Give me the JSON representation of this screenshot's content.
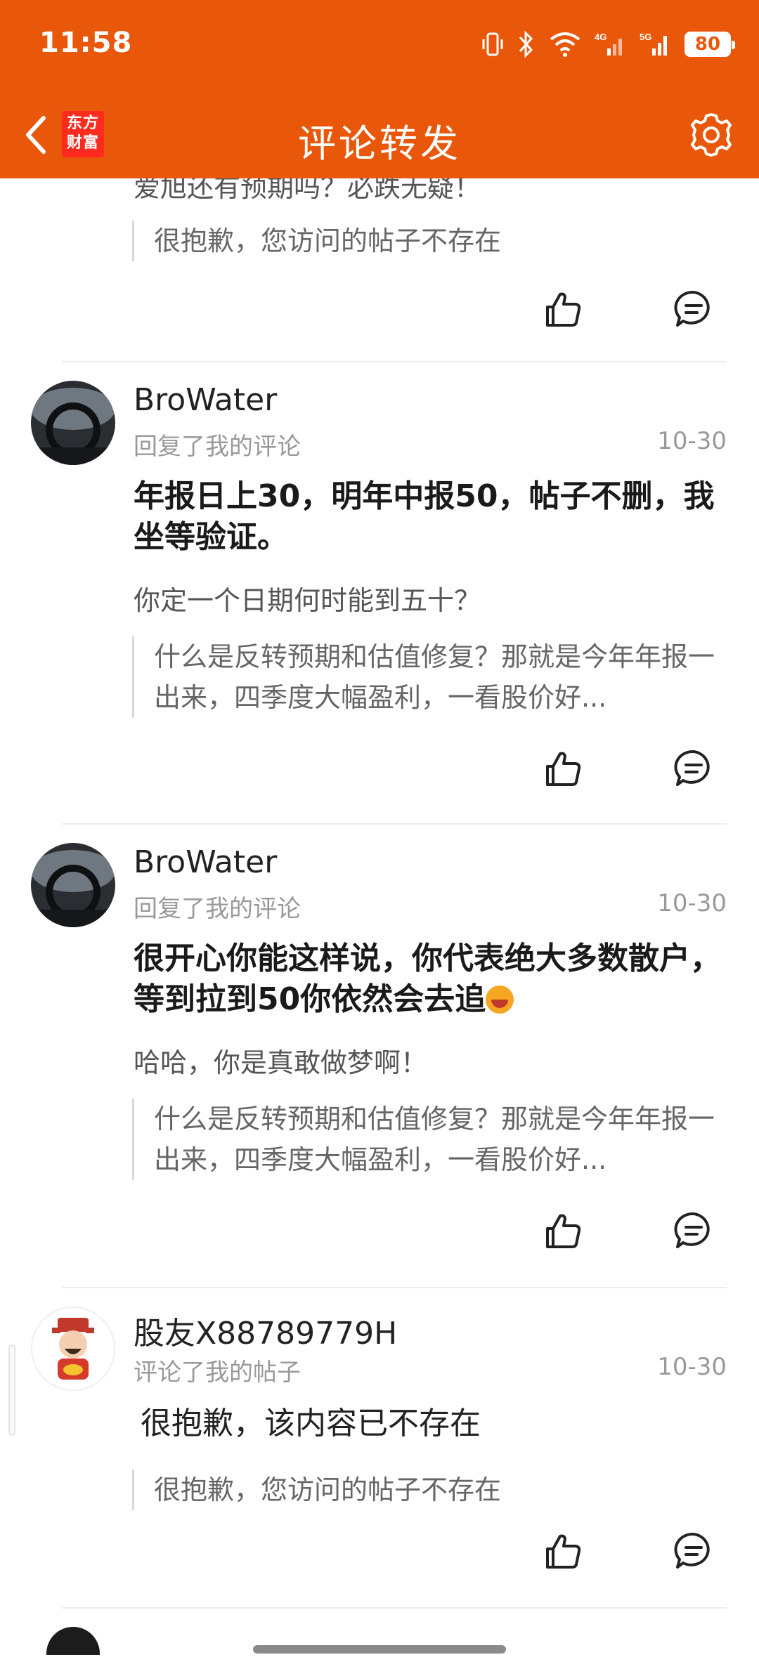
{
  "status_bar": {
    "time": "11:58",
    "battery": "80"
  },
  "nav": {
    "title": "评论转发",
    "logo_line1": "东方",
    "logo_line2": "财富"
  },
  "top_partial": {
    "text": "爱旭还有预期吗？必跌无疑！",
    "quote": "很抱歉，您访问的帖子不存在"
  },
  "items": [
    {
      "username": "BroWater",
      "action": "回复了我的评论",
      "date": "10-30",
      "comment": "年报日上30，明年中报50，帖子不删，我坐等验证。",
      "reply": "你定一个日期何时能到五十？",
      "quote": "什么是反转预期和估值修复？那就是今年年报一出来，四季度大幅盈利，一看股价好..."
    },
    {
      "username": "BroWater",
      "action": "回复了我的评论",
      "date": "10-30",
      "comment": "很开心你能这样说，你代表绝大多数散户，等到拉到50你依然会去追",
      "reply": "哈哈，你是真敢做梦啊！",
      "quote": "什么是反转预期和估值修复？那就是今年年报一出来，四季度大幅盈利，一看股价好..."
    },
    {
      "username": "股友X88789779H",
      "action": "评论了我的帖子",
      "date": "10-30",
      "comment": "很抱歉，该内容已不存在",
      "quote": "很抱歉，您访问的帖子不存在"
    }
  ],
  "icons": {
    "back": "chevron-left-icon",
    "settings": "gear-icon",
    "like": "thumbs-up-icon",
    "reply": "comment-bubble-icon"
  },
  "colors": {
    "accent": "#e9570a",
    "text": "#1a1a1a",
    "muted": "#999999"
  }
}
